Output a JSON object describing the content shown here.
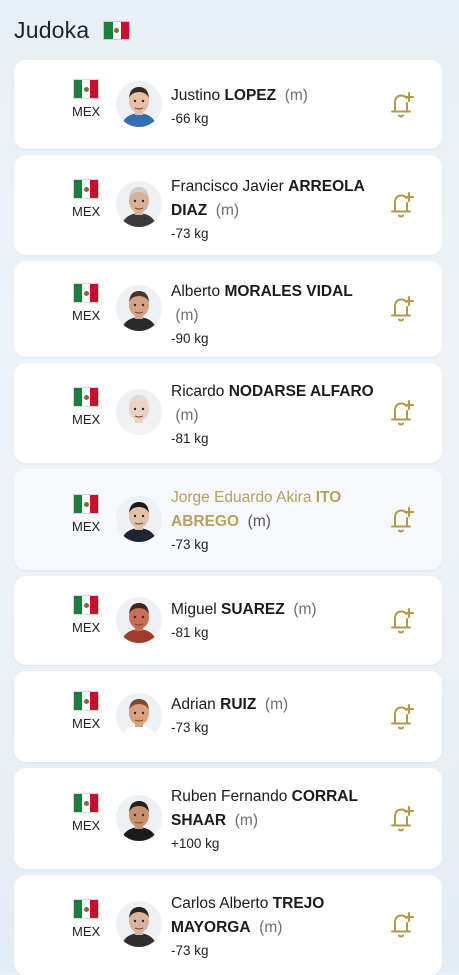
{
  "page": {
    "title": "Judoka",
    "country_flag_icon": "mexico-flag-icon"
  },
  "colors": {
    "highlight": "#b6a25a",
    "bell": "#b19a44"
  },
  "athletes": [
    {
      "country": "MEX",
      "first": "Justino",
      "last": "LOPEZ",
      "gender": "(m)",
      "weight": "-66 kg",
      "selected": false
    },
    {
      "country": "MEX",
      "first": "Francisco Javier",
      "last": "ARREOLA DIAZ",
      "gender": "(m)",
      "weight": "-73 kg",
      "selected": false
    },
    {
      "country": "MEX",
      "first": "Alberto",
      "last": "MORALES VIDAL",
      "gender": "(m)",
      "weight": "-90 kg",
      "selected": false
    },
    {
      "country": "MEX",
      "first": "Ricardo",
      "last": "NODARSE ALFARO",
      "gender": "(m)",
      "weight": "-81 kg",
      "selected": false
    },
    {
      "country": "MEX",
      "first": "Jorge Eduardo Akira",
      "last": "ITO ABREGO",
      "gender": "(m)",
      "weight": "-73 kg",
      "selected": true
    },
    {
      "country": "MEX",
      "first": "Miguel",
      "last": "SUAREZ",
      "gender": "(m)",
      "weight": "-81 kg",
      "selected": false
    },
    {
      "country": "MEX",
      "first": "Adrian",
      "last": "RUIZ",
      "gender": "(m)",
      "weight": "-73 kg",
      "selected": false
    },
    {
      "country": "MEX",
      "first": "Ruben Fernando",
      "last": "CORRAL SHAAR",
      "gender": "(m)",
      "weight": "+100 kg",
      "selected": false
    },
    {
      "country": "MEX",
      "first": "Carlos Alberto",
      "last": "TREJO MAYORGA",
      "gender": "(m)",
      "weight": "-73 kg",
      "selected": false
    }
  ]
}
